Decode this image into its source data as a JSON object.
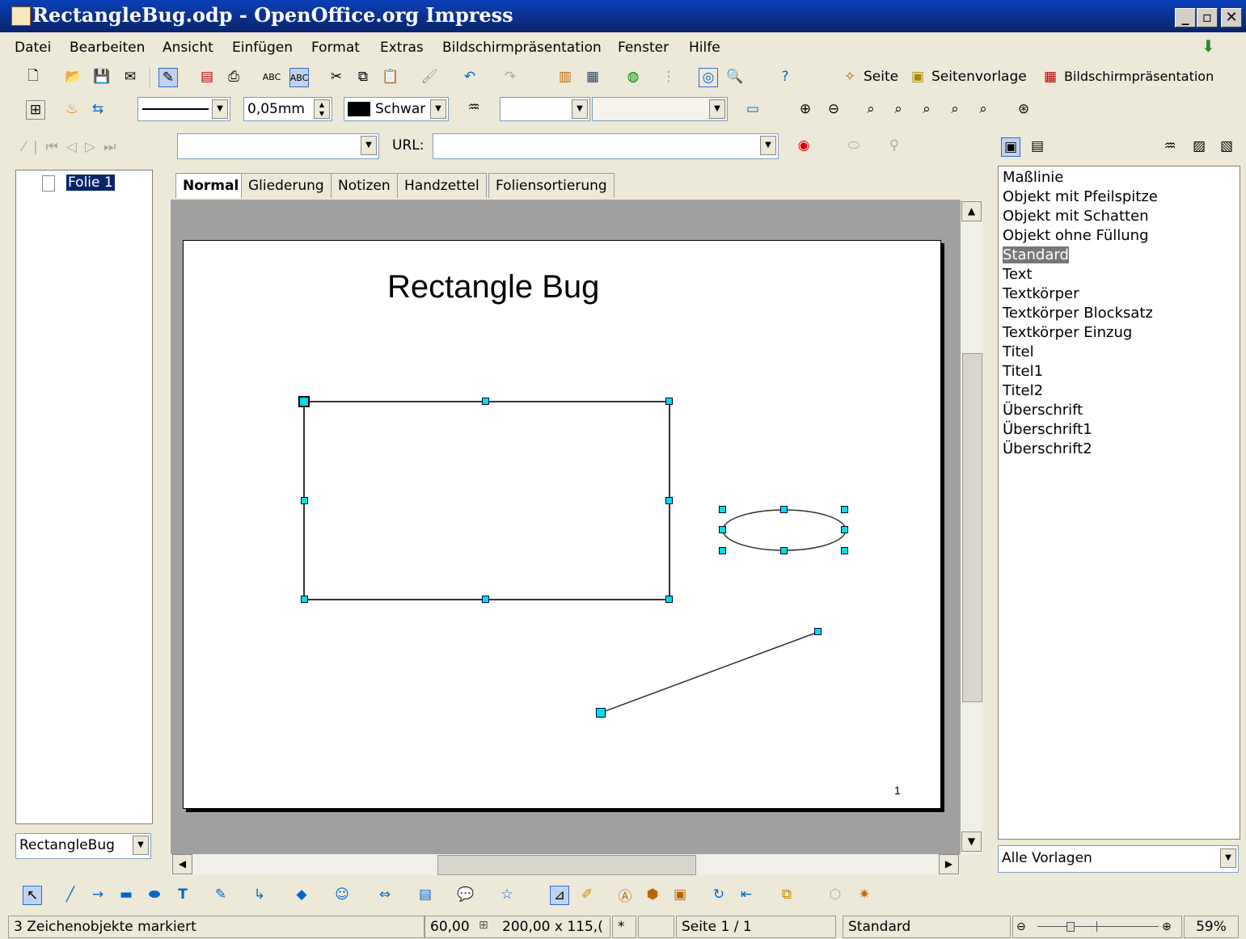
{
  "window": {
    "title": "RectangleBug.odp - OpenOffice.org Impress"
  },
  "menu": [
    "Datei",
    "Bearbeiten",
    "Ansicht",
    "Einfügen",
    "Format",
    "Extras",
    "Bildschirmpräsentation",
    "Fenster",
    "Hilfe"
  ],
  "toolbar": {
    "seite": "Seite",
    "seitenvorlage": "Seitenvorlage",
    "praesentation": "Bildschirmpräsentation"
  },
  "line_toolbar": {
    "line_width": "0,05mm",
    "line_color": "Schwar"
  },
  "hyperlink": {
    "url_label": "URL:",
    "url_value": "",
    "text_value": ""
  },
  "slides_pane": {
    "items": [
      "Folie 1"
    ],
    "layout_select": "RectangleBug"
  },
  "view_tabs": [
    "Normal",
    "Gliederung",
    "Notizen",
    "Handzettel",
    "Foliensortierung"
  ],
  "slide": {
    "title": "Rectangle Bug",
    "page_number": "1"
  },
  "styles": {
    "items": [
      "Maßlinie",
      "Objekt mit Pfeilspitze",
      "Objekt mit Schatten",
      "Objekt ohne Füllung",
      "Standard",
      "Text",
      "Textkörper",
      "Textkörper Blocksatz",
      "Textkörper Einzug",
      "Titel",
      "Titel1",
      "Titel2",
      "Überschrift",
      "Überschrift1",
      "Überschrift2"
    ],
    "selected": "Standard",
    "filter": "Alle Vorlagen"
  },
  "status": {
    "selection": "3 Zeichenobjekte markiert",
    "position": "60,00",
    "size": "200,00 x 115,(",
    "modified": "*",
    "page": "Seite 1 / 1",
    "master": "Standard",
    "zoom": "59%",
    "zoom_level": 0.59
  },
  "colors": {
    "title_bar": "#0a246a",
    "handle": "#00e0e0",
    "selection": "#0a246a"
  }
}
